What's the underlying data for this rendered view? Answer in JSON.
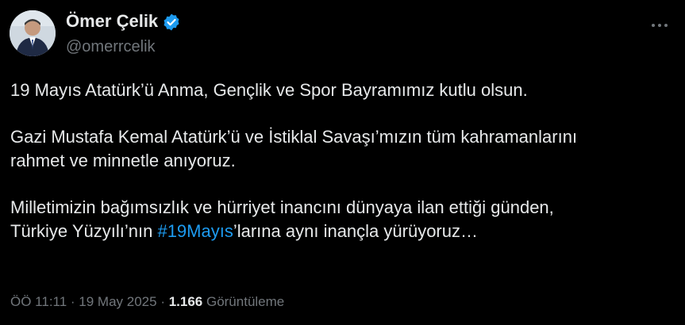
{
  "author": {
    "display_name": "Ömer Çelik",
    "handle": "@omerrcelik",
    "verified_icon": "verified-badge-icon",
    "avatar_icon": "profile-photo"
  },
  "tweet": {
    "line1": "19 Mayıs Atatürk’ü Anma, Gençlik ve Spor Bayramımız kutlu olsun.",
    "line2": "Gazi Mustafa Kemal Atatürk’ü ve İstiklal Savaşı’mızın tüm kahramanlarını",
    "line3": "rahmet ve minnetle anıyoruz.",
    "line4": "Milletimizin bağımsızlık ve hürriyet inancını dünyaya ilan ettiği günden,",
    "line5_before": "Türkiye Yüzyılı’nın ",
    "hashtag": "#19Mayıs",
    "line5_after": "’larına aynı inançla yürüyoruz…"
  },
  "meta": {
    "time": "ÖÖ 11:11",
    "separator": " · ",
    "date": "19 May 2025",
    "views_count": "1.166",
    "views_label": " Görüntüleme"
  },
  "colors": {
    "background": "#000000",
    "text": "#e7e9ea",
    "secondary": "#71767b",
    "link": "#1d9bf0"
  },
  "more_icon": "more-horizontal-icon"
}
